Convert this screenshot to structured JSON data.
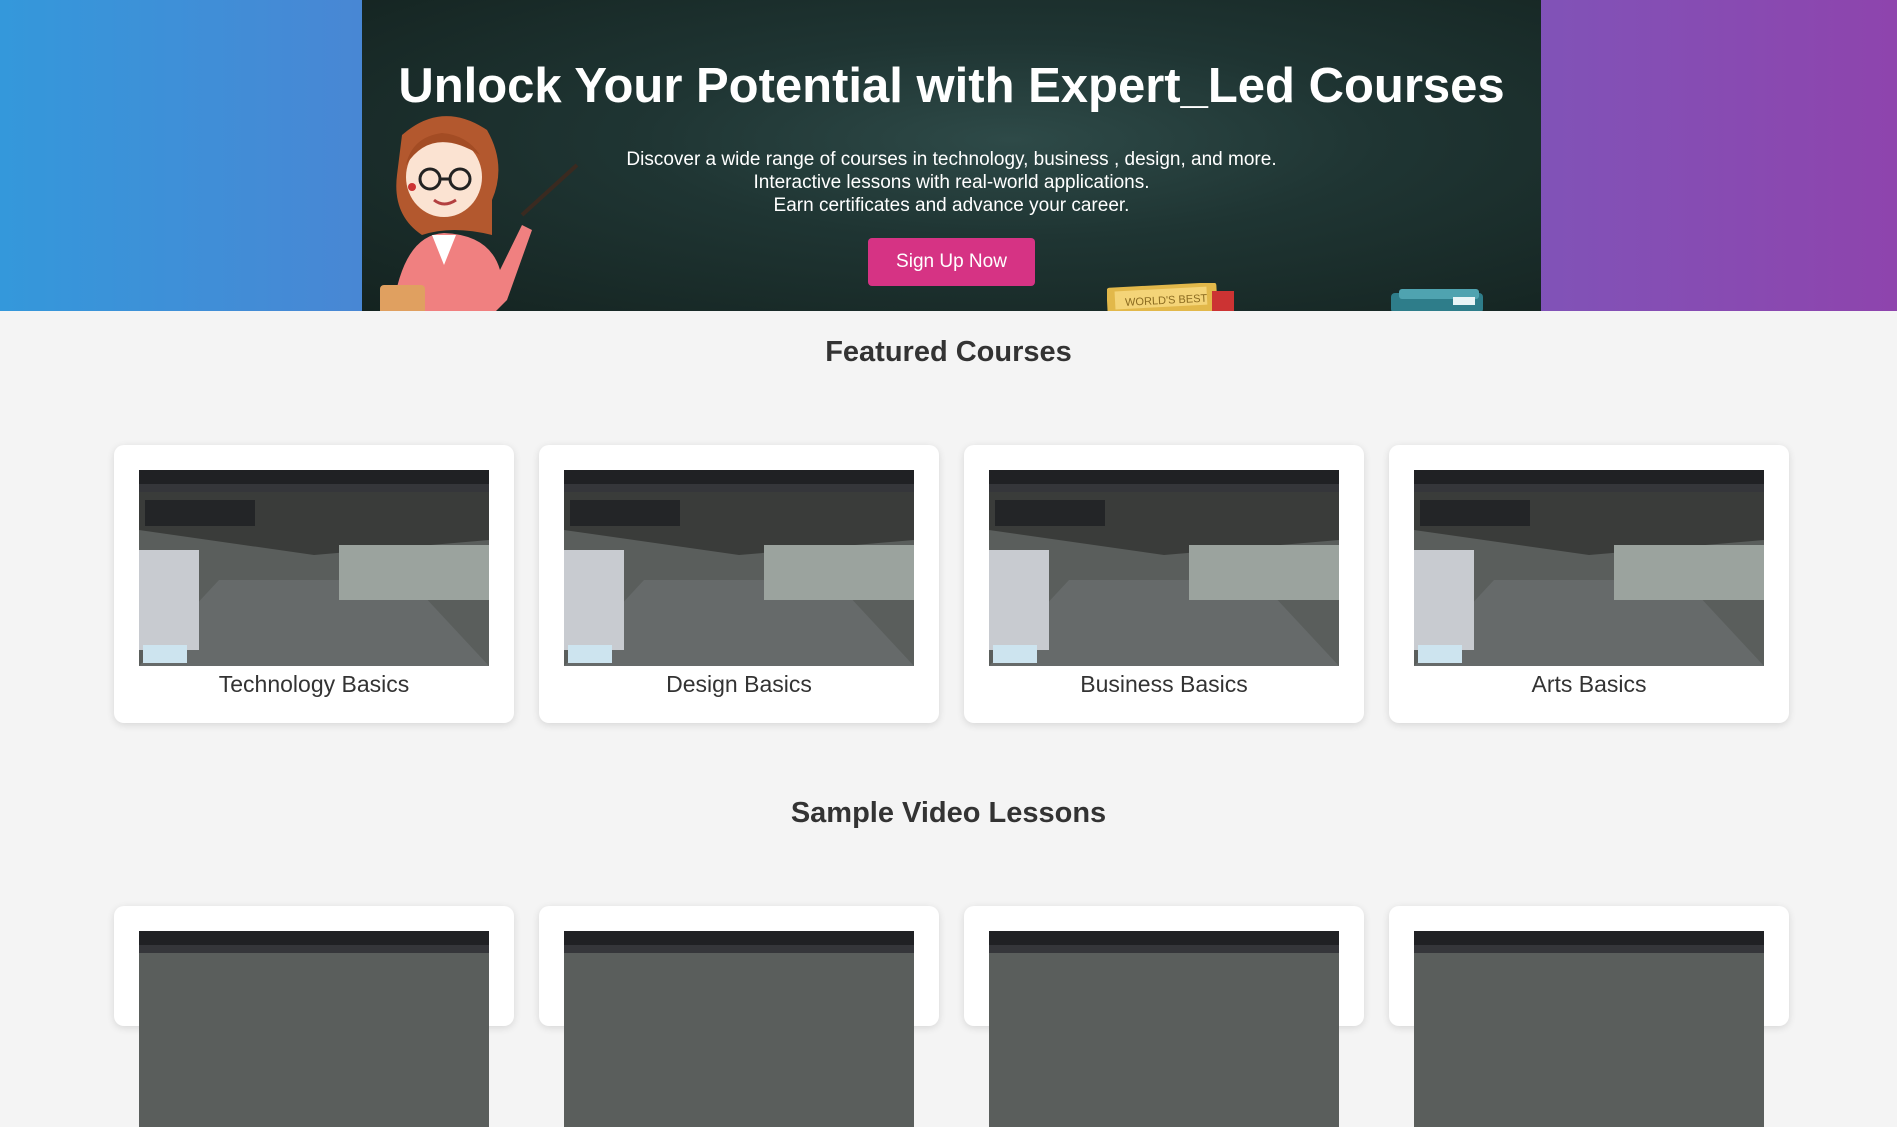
{
  "hero": {
    "title": "Unlock Your Potential with Expert_Led Courses",
    "lines": [
      "Discover a wide range of courses in technology, business , design, and more.",
      "Interactive lessons with real-world applications.",
      "Earn certificates and advance your career."
    ],
    "cta_label": "Sign Up Now",
    "book_label": "WORLD'S BEST"
  },
  "featured": {
    "title": "Featured Courses",
    "courses": [
      {
        "label": "Technology Basics"
      },
      {
        "label": "Design Basics"
      },
      {
        "label": "Business Basics"
      },
      {
        "label": "Arts Basics"
      }
    ]
  },
  "lessons": {
    "title": "Sample Video Lessons"
  },
  "colors": {
    "accent": "#d63384",
    "gradient_start": "#3498db",
    "gradient_end": "#8e44ad"
  }
}
